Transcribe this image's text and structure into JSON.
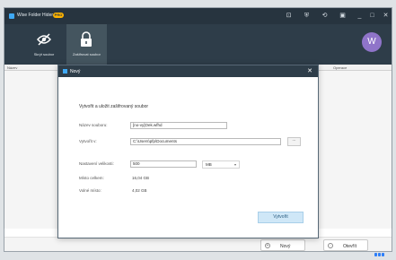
{
  "app": {
    "title": "Wise Folder Hider",
    "badge": "PRO",
    "window_controls": [
      "⊡",
      "⛨",
      "⟲",
      "▣",
      "_",
      "□",
      "✕"
    ]
  },
  "toolbar": {
    "tabs": [
      {
        "label": "Skrýt soubor",
        "icon": "eye-slash-icon",
        "active": false
      },
      {
        "label": "Zašifrovat soubor",
        "icon": "lock-icon",
        "active": true
      }
    ],
    "avatar_letter": "W"
  },
  "table": {
    "columns": [
      "Název",
      "Stav",
      "Operace"
    ]
  },
  "footer": {
    "new_label": "Nový",
    "open_label": "Otevřít"
  },
  "dialog": {
    "title": "Nový",
    "heading": "Vytvořit a uložit zašifrovaný soubor",
    "filename_label": "Název souboru:",
    "filename_value": "[no-vy]Oek.wfhd",
    "createin_label": "Vytvořit v:",
    "createin_value": "C:\\Users\\pfp\\Documents",
    "browse_label": "...",
    "size_label": "Nastavení velikosti:",
    "size_value": "500",
    "unit_value": "MB",
    "total_label": "Místo celkem:",
    "total_value": "16,04 GB",
    "free_label": "Volné místo:",
    "free_value": "4,02 GB",
    "create_label": "Vytvořit"
  },
  "colors": {
    "titlebar": "#27343f",
    "toolbar": "#2e3d49",
    "accent": "#3fa9f5",
    "avatar": "#8f74c9",
    "create_button": "#cfe7f7"
  }
}
